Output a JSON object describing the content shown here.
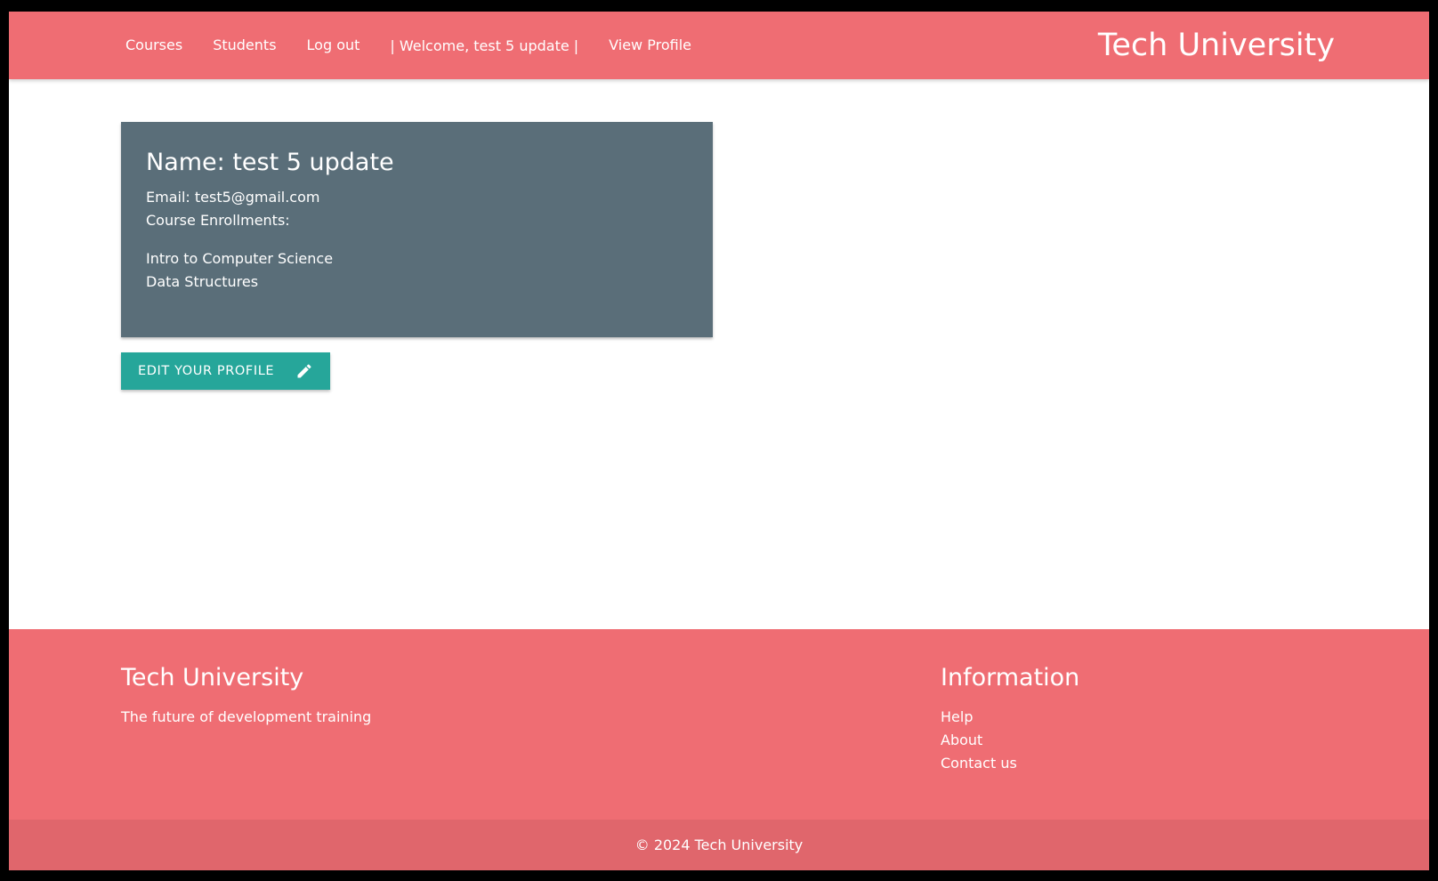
{
  "nav": {
    "links": [
      "Courses",
      "Students",
      "Log out"
    ],
    "welcome": "| Welcome, test 5 update |",
    "view_profile": "View Profile",
    "brand": "Tech University"
  },
  "profile": {
    "name": "Name: test 5 update",
    "email": "Email: test5@gmail.com",
    "enrollments_label": "Course Enrollments:",
    "courses": [
      "Intro to Computer Science",
      "Data Structures"
    ]
  },
  "edit_button": {
    "label": "EDIT YOUR PROFILE",
    "icon": "pencil-icon"
  },
  "footer": {
    "brand": "Tech University",
    "tagline": "The future of development training",
    "info_title": "Information",
    "links": [
      "Help",
      "About",
      "Contact us"
    ],
    "copyright": "© 2024 Tech University"
  },
  "colors": {
    "primary": "#ef6d73",
    "card": "#5a6e79",
    "button": "#26a69a",
    "copyright_bar": "#e0666c"
  }
}
